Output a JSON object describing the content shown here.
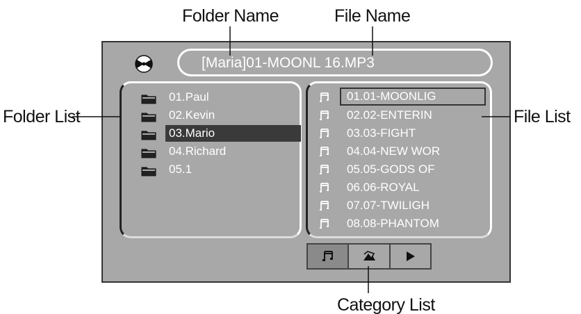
{
  "callouts": {
    "folder_name": "Folder Name",
    "file_name": "File Name",
    "folder_list": "Folder List",
    "file_list": "File List",
    "category_list": "Category List"
  },
  "screen": {
    "title": "[Maria]01-MOONL 16.MP3",
    "folders": [
      "01.Paul",
      "02.Kevin",
      "03.Mario",
      "04.Richard",
      "05.1"
    ],
    "selected_folder_index": 2,
    "files": [
      "01.01-MOONLIG",
      "02.02-ENTERIN",
      "03.03-FIGHT",
      "04.04-NEW WOR",
      "05.05-GODS OF",
      "06.06-ROYAL",
      "07.07-TWILIGH",
      "08.08-PHANTOM"
    ],
    "selected_file_index": 0,
    "categories": [
      {
        "icon": "music-note-icon",
        "active": true
      },
      {
        "icon": "photo-icon",
        "active": false
      },
      {
        "icon": "play-icon",
        "active": false
      }
    ]
  },
  "colors": {
    "screen_background": "#a8a8a8",
    "text": "#ffffff",
    "selection": "#3a3a3a"
  }
}
